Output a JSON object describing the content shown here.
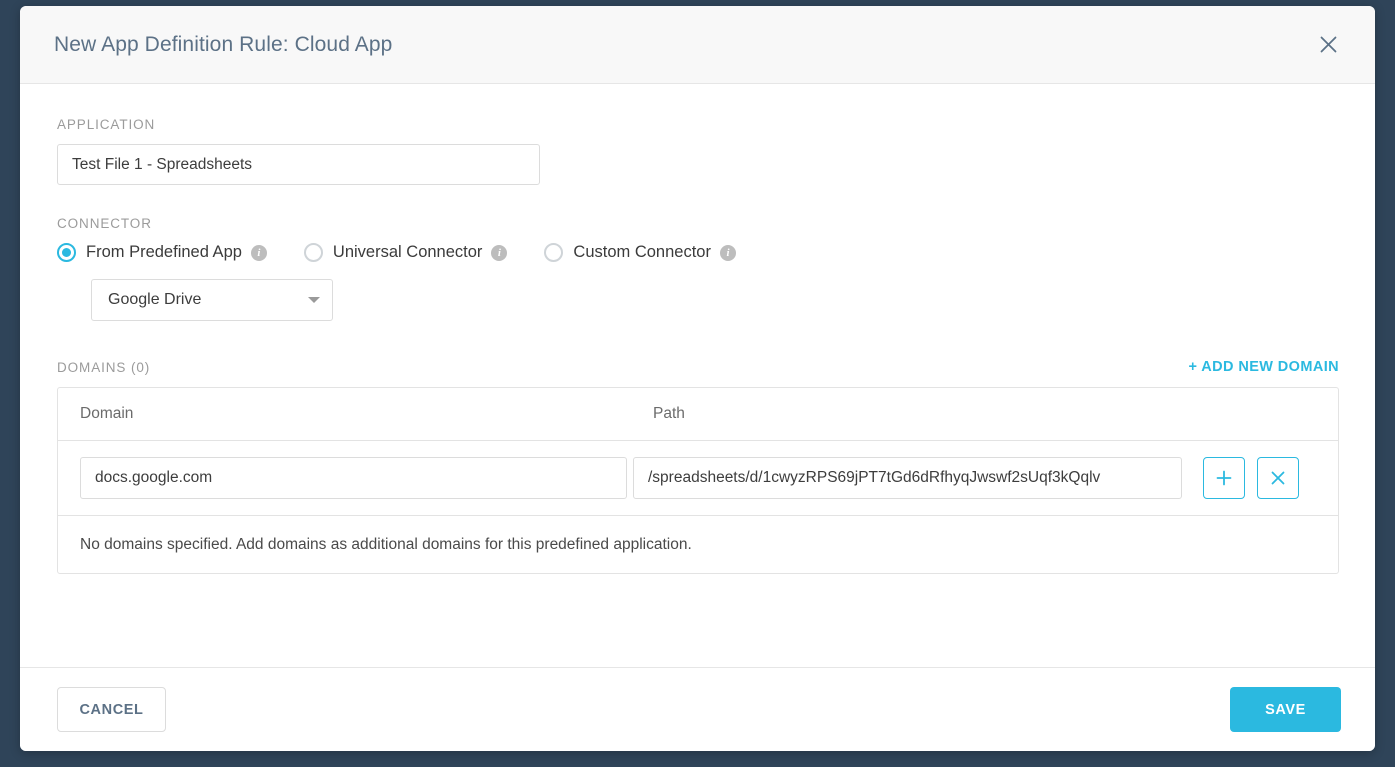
{
  "modal": {
    "title": "New App Definition Rule: Cloud App",
    "close_icon": "close-icon"
  },
  "application": {
    "label": "APPLICATION",
    "value": "Test File 1 - Spreadsheets",
    "placeholder": ""
  },
  "connector": {
    "label": "CONNECTOR",
    "options": [
      {
        "label": "From Predefined App",
        "selected": true,
        "info_icon": "info-icon"
      },
      {
        "label": "Universal Connector",
        "selected": false,
        "info_icon": "info-icon"
      },
      {
        "label": "Custom Connector",
        "selected": false,
        "info_icon": "info-icon"
      }
    ],
    "predefined_app": {
      "value": "Google Drive",
      "caret_icon": "chevron-down-icon"
    }
  },
  "domains": {
    "label": "DOMAINS (0)",
    "count": 0,
    "add_link": "+ ADD NEW DOMAIN",
    "columns": {
      "domain": "Domain",
      "path": "Path"
    },
    "rows": [
      {
        "domain": "docs.google.com",
        "path": "/spreadsheets/d/1cwyzRPS69jPT7tGd6dRfhyqJwswf2sUqf3kQqlv",
        "add_icon": "plus-icon",
        "remove_icon": "close-icon"
      }
    ],
    "empty_message": "No domains specified. Add domains as additional domains for this predefined application."
  },
  "footer": {
    "cancel_label": "CANCEL",
    "save_label": "SAVE"
  },
  "colors": {
    "accent": "#2bb9e0",
    "title_text": "#5c7186",
    "page_background": "#2f4459"
  }
}
